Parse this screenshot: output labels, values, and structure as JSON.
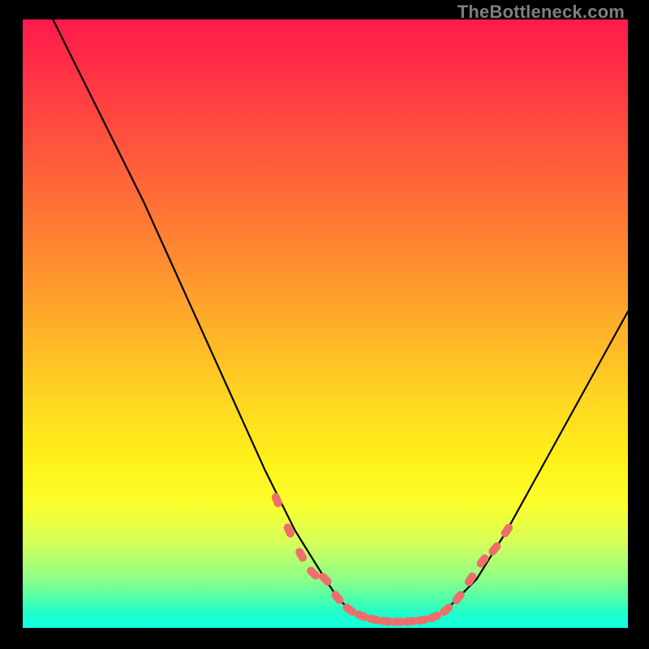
{
  "watermark": "TheBottleneck.com",
  "colors": {
    "background": "#000000",
    "curve": "#000000",
    "markers": "#ef6e6a",
    "watermark": "#7f7f80"
  },
  "chart_data": {
    "type": "line",
    "title": "",
    "xlabel": "",
    "ylabel": "",
    "xlim": [
      0,
      100
    ],
    "ylim": [
      0,
      100
    ],
    "grid": false,
    "legend": false,
    "series": [
      {
        "name": "bottleneck-curve",
        "x": [
          0,
          5,
          10,
          15,
          20,
          25,
          30,
          35,
          40,
          45,
          50,
          52,
          54,
          56,
          58,
          60,
          62,
          64,
          66,
          68,
          70,
          75,
          80,
          85,
          90,
          95,
          100
        ],
        "y": [
          110,
          100,
          90,
          80,
          70,
          59,
          48,
          37,
          26,
          16,
          8,
          5,
          3,
          2,
          1.4,
          1.1,
          1,
          1.1,
          1.3,
          1.8,
          3,
          8,
          16,
          25,
          34,
          43,
          52
        ]
      }
    ],
    "markers": {
      "name": "highlight-points",
      "x": [
        42,
        44,
        46,
        48,
        50,
        52,
        54,
        56,
        58,
        60,
        62,
        64,
        66,
        68,
        70,
        72,
        74,
        76,
        78,
        80
      ],
      "y": [
        21,
        16,
        12,
        9,
        8,
        5,
        3,
        2,
        1.4,
        1.1,
        1,
        1.1,
        1.3,
        1.8,
        3,
        5,
        8,
        11,
        13,
        16
      ]
    },
    "gradient_stops": [
      {
        "pct": 0,
        "color": "#ff1a4d"
      },
      {
        "pct": 50,
        "color": "#ffb428"
      },
      {
        "pct": 80,
        "color": "#fbff2e"
      },
      {
        "pct": 100,
        "color": "#14ffe0"
      }
    ]
  }
}
